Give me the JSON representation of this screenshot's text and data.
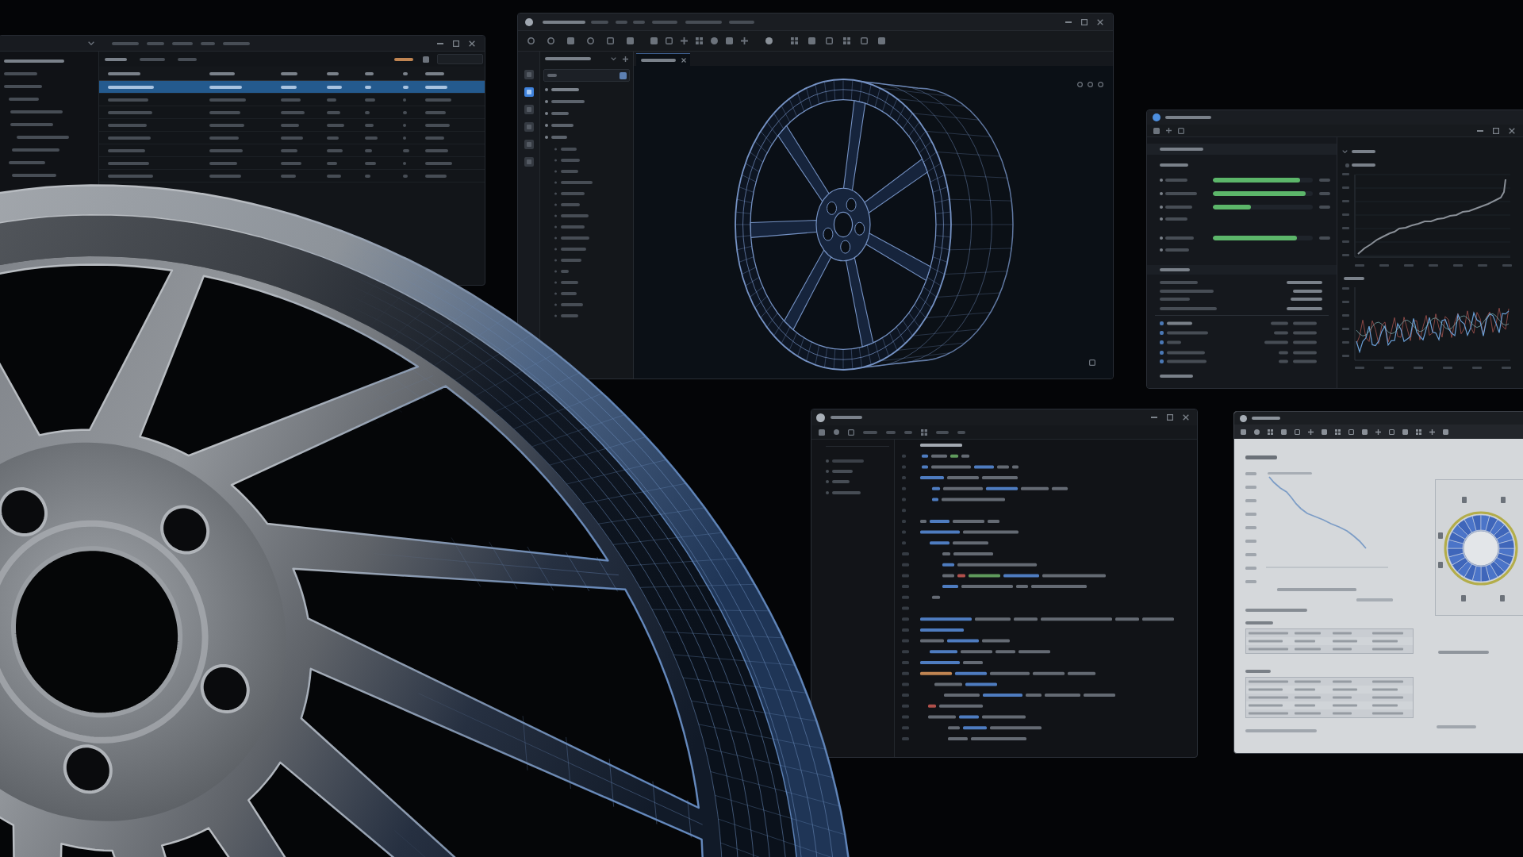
{
  "windows": [
    {
      "kind": "table",
      "rows": [
        {
          "selected": true
        },
        {
          "selected": false
        },
        {
          "selected": false
        },
        {
          "selected": false
        },
        {
          "selected": false
        },
        {
          "selected": false
        },
        {
          "selected": false
        },
        {
          "selected": false
        }
      ]
    },
    {
      "kind": "cad",
      "activity_bar": [
        {
          "selected": false
        },
        {
          "selected": true
        },
        {
          "selected": false
        },
        {
          "selected": false
        },
        {
          "selected": false
        },
        {
          "selected": false
        }
      ]
    },
    {
      "kind": "dashboard",
      "rows": [
        {
          "kind": "meter",
          "level": 0.87
        },
        {
          "kind": "meter",
          "level": 0.93
        },
        {
          "kind": "meter",
          "level": 0.38
        },
        {
          "kind": "plain"
        },
        {
          "kind": "meter",
          "level": 0.84
        },
        {
          "kind": "plain"
        }
      ]
    },
    {
      "kind": "code"
    },
    {
      "kind": "report"
    }
  ]
}
